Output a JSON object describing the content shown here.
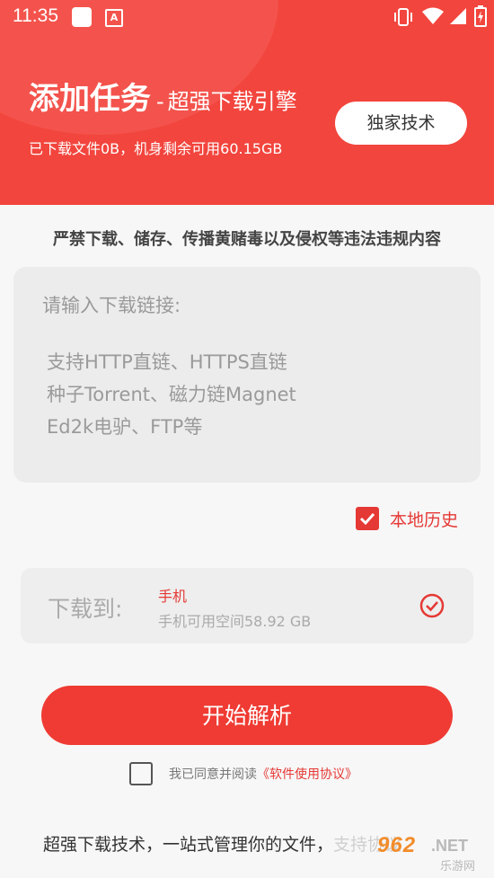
{
  "status_bar": {
    "time": "11:35",
    "notif_icon": "A"
  },
  "header": {
    "title": "添加任务",
    "dash": "-",
    "subtitle": "超强下载引擎",
    "stats": "已下载文件0B，机身剩余可用60.15GB",
    "exclusive_label": "独家技术",
    "color": "#f2453d"
  },
  "warning": "严禁下载、储存、传播黄赌毒以及侵权等违法违规内容",
  "url_input": {
    "placeholder": "请输入下载链接:",
    "hints": [
      "支持HTTP直链、HTTPS直链",
      "种子Torrent、磁力链Magnet",
      "Ed2k电驴、FTP等"
    ]
  },
  "history": {
    "label": "本地历史",
    "checked": true
  },
  "destination": {
    "label": "下载到:",
    "name": "手机",
    "space": "手机可用空间58.92 GB"
  },
  "start_label": "开始解析",
  "agreement": {
    "text": "我已同意并阅读",
    "link": "《软件使用协议》",
    "checked": false
  },
  "footer": {
    "text": "超强下载技术，一站式管理你的文件，",
    "extra": "支持协议"
  },
  "watermark": {
    "number": "962",
    "suffix": ".NET",
    "cn": "乐游网"
  },
  "accent_color": "#e53935"
}
